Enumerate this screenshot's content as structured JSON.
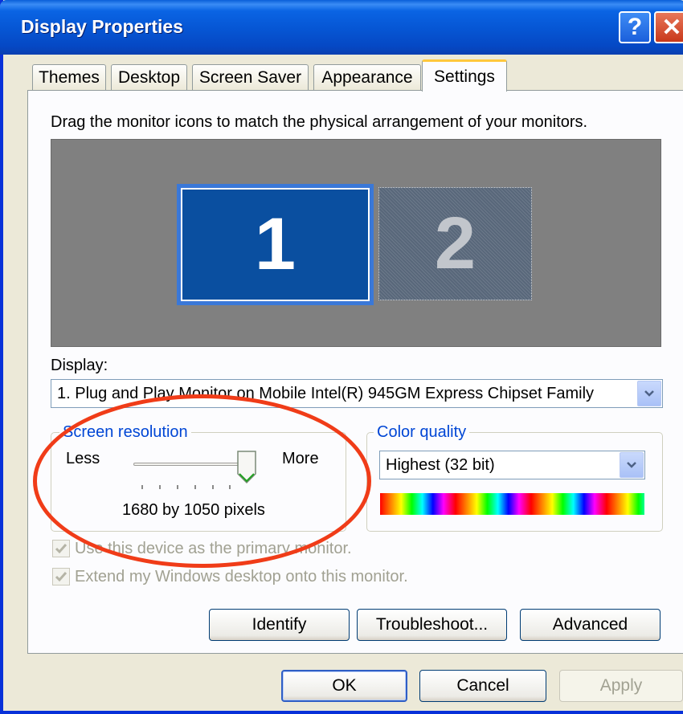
{
  "window": {
    "title": "Display Properties"
  },
  "titlebar": {
    "help_glyph": "?",
    "close_glyph": "✕"
  },
  "tabs": [
    {
      "label": "Themes",
      "active": false
    },
    {
      "label": "Desktop",
      "active": false
    },
    {
      "label": "Screen Saver",
      "active": false
    },
    {
      "label": "Appearance",
      "active": false
    },
    {
      "label": "Settings",
      "active": true
    }
  ],
  "settings": {
    "instruction": "Drag the monitor icons to match the physical arrangement of your monitors.",
    "monitors": [
      {
        "number": "1",
        "selected": true
      },
      {
        "number": "2",
        "selected": false
      }
    ],
    "display_label": "Display:",
    "display_value": "1. Plug and Play Monitor on Mobile Intel(R) 945GM Express Chipset Family",
    "resolution": {
      "label": "Screen resolution",
      "less": "Less",
      "more": "More",
      "value_text": "1680 by 1050 pixels",
      "slider_position": 1.0
    },
    "color_quality": {
      "label": "Color quality",
      "value": "Highest (32 bit)"
    },
    "checkboxes": [
      {
        "label": "Use this device as the primary monitor.",
        "checked": true,
        "enabled": false
      },
      {
        "label": "Extend my Windows desktop onto this monitor.",
        "checked": true,
        "enabled": false
      }
    ],
    "buttons": {
      "identify": "Identify",
      "troubleshoot": "Troubleshoot...",
      "advanced": "Advanced"
    }
  },
  "footer": {
    "ok": "OK",
    "cancel": "Cancel",
    "apply": "Apply"
  },
  "colors": {
    "title_blue": "#0a5fd8",
    "accent_tab": "#ffc83c",
    "annotation_red": "#f03c18",
    "monitor_selected": "#0a4fa0"
  }
}
